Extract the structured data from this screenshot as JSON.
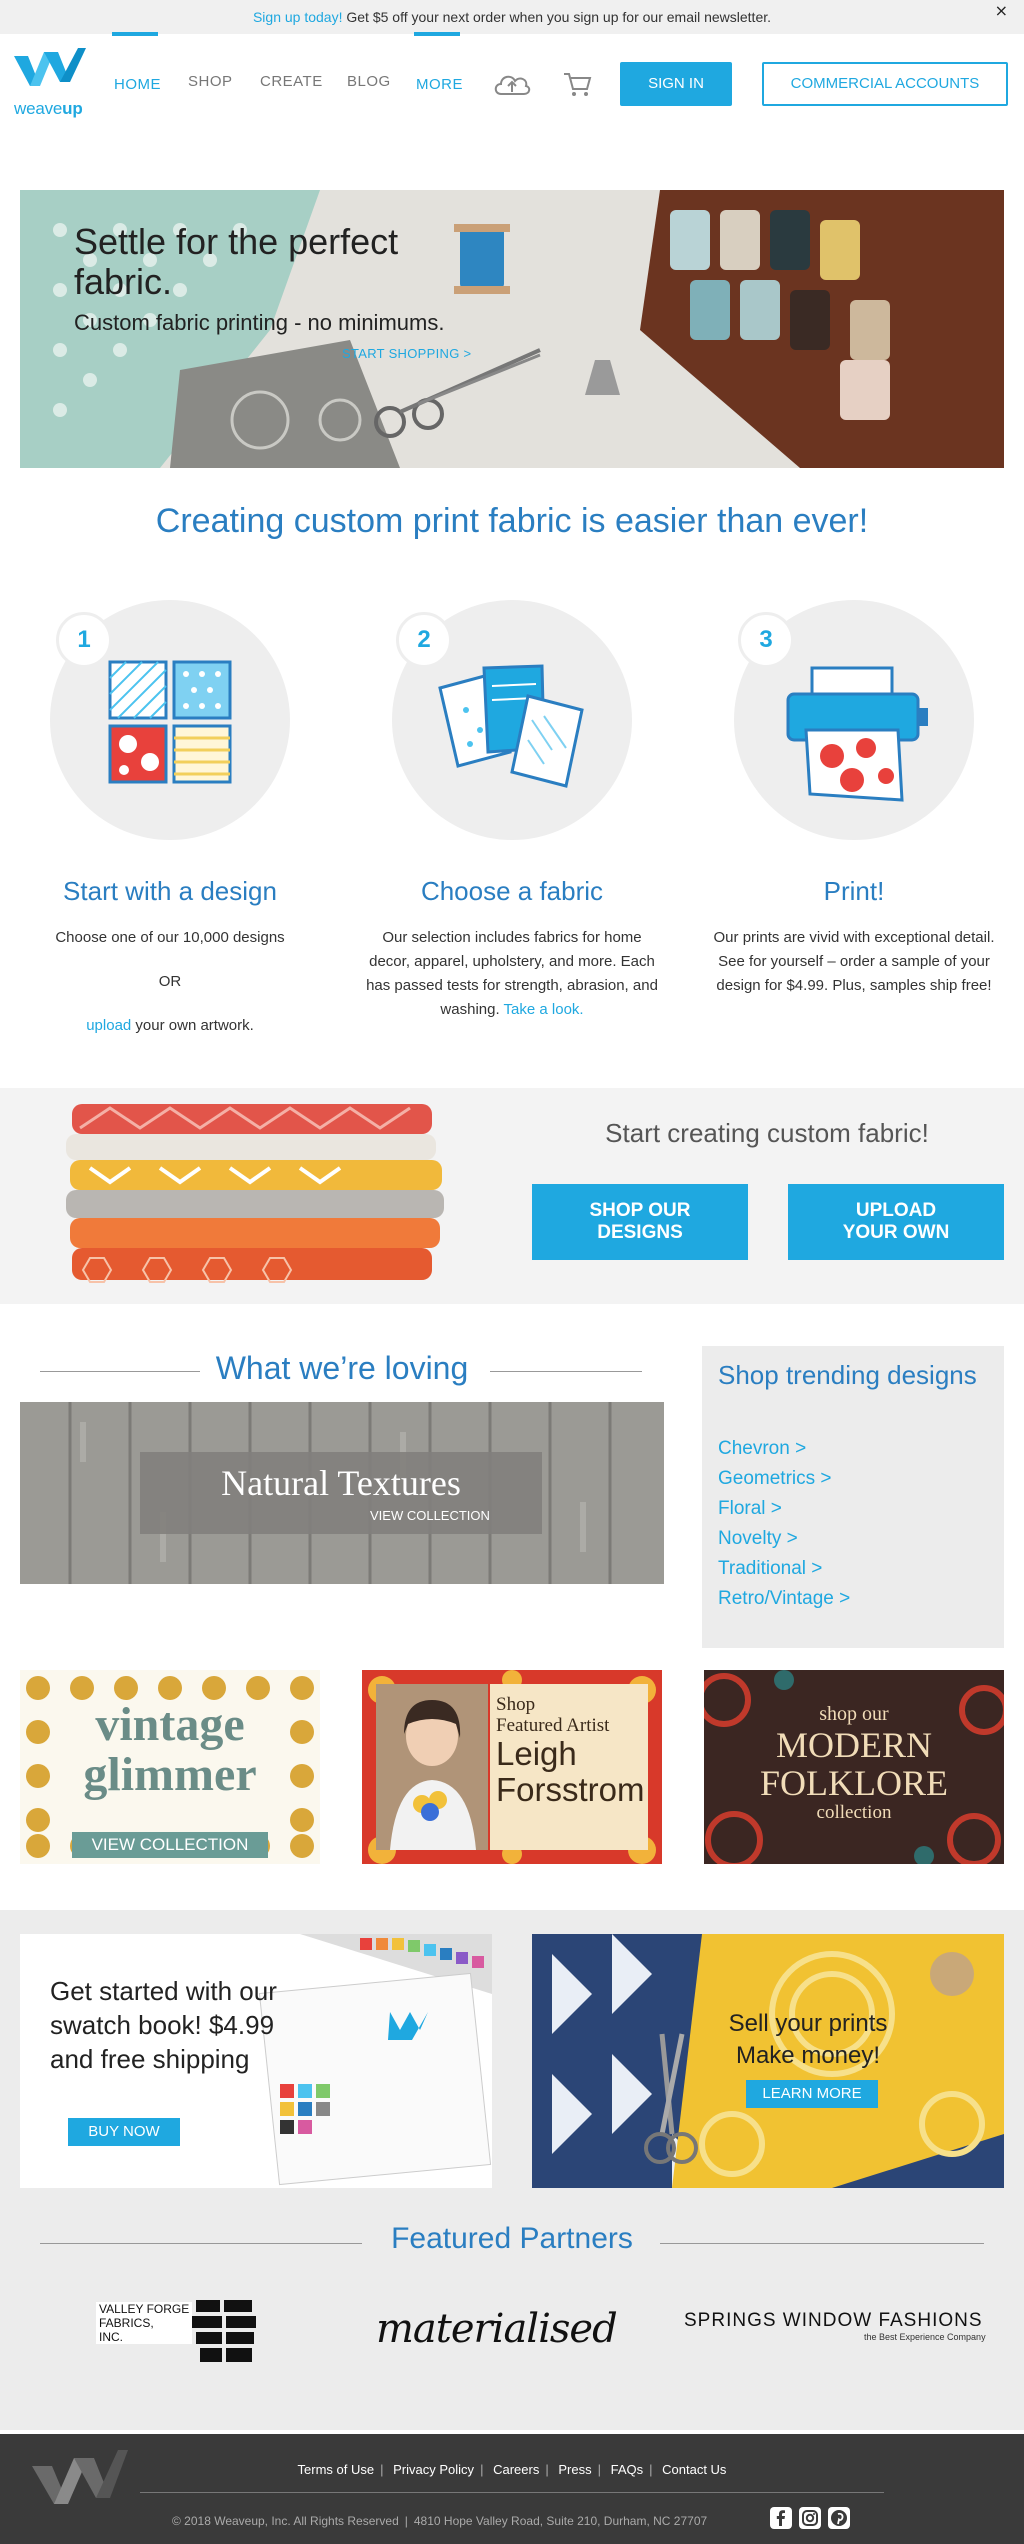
{
  "promo": {
    "highlight": "Sign up today!",
    "text": " Get $5 off your next order when you sign up for our email newsletter.",
    "close": "×"
  },
  "header": {
    "logo_word_a": "weave",
    "logo_word_b": "up",
    "nav": [
      {
        "label": "HOME"
      },
      {
        "label": "SHOP"
      },
      {
        "label": "CREATE"
      },
      {
        "label": "BLOG"
      },
      {
        "label": "MORE"
      }
    ],
    "signin": "SIGN IN",
    "commercial": "COMMERCIAL ACCOUNTS"
  },
  "hero": {
    "title": "Settle for the perfect fabric.",
    "subtitle": "Custom fabric printing - no minimums.",
    "cta": "START SHOPPING >"
  },
  "how": {
    "title": "Creating custom print fabric is easier than ever!",
    "steps": [
      {
        "num": "1",
        "title": "Start with a design",
        "line1": "Choose one of our 10,000 designs",
        "or": "OR",
        "upload_link": "upload",
        "upload_rest": " your own artwork."
      },
      {
        "num": "2",
        "title": "Choose a fabric",
        "text": "Our selection includes fabrics for home decor, apparel, upholstery, and more. Each has passed tests for strength, abrasion, and washing. ",
        "link": "Take a look."
      },
      {
        "num": "3",
        "title": "Print!",
        "text": "Our prints are vivid with exceptional detail. See for yourself – order a sample of your design for $4.99. Plus, samples ship free!"
      }
    ]
  },
  "band": {
    "title": "Start creating custom fabric!",
    "btn_shop": "SHOP OUR DESIGNS",
    "btn_upload": "UPLOAD YOUR OWN"
  },
  "loving": {
    "title": "What we’re loving",
    "feature_title": "Natural Textures",
    "feature_link": "VIEW COLLECTION"
  },
  "trending": {
    "title": "Shop trending designs",
    "items": [
      "Chevron >",
      "Geometrics >",
      "Floral >",
      "Novelty >",
      "Traditional >",
      "Retro/Vintage >"
    ]
  },
  "collections": {
    "vintage_a": "vintage",
    "vintage_b": "glimmer",
    "vintage_btn": "VIEW COLLECTION",
    "artist_shop": "Shop",
    "artist_featured": "Featured Artist",
    "artist_first": "Leigh",
    "artist_last": "Forsstrom",
    "folk_shop": "shop our",
    "folk_modern": "MODERN",
    "folk_folklore": "FOLKLORE",
    "folk_collection": "collection"
  },
  "swatch": {
    "text": "Get started with our swatch book! $4.99 and free shipping",
    "btn": "BUY NOW"
  },
  "sell": {
    "text": "Sell your prints Make money!",
    "btn": "LEARN MORE"
  },
  "partners": {
    "title": "Featured Partners",
    "vf_1": "VALLEY FORGE",
    "vf_2": "FABRICS,",
    "vf_3": "INC.",
    "materialised": "materialised",
    "springs": "SPRINGS WINDOW FASHIONS",
    "springs_tag": "the Best Experience Company"
  },
  "footer": {
    "links": [
      "Terms of Use",
      "Privacy Policy",
      "Careers",
      "Press",
      "FAQs",
      "Contact Us"
    ],
    "copyright": "© 2018 Weaveup, Inc. All Rights Reserved",
    "address": "4810 Hope Valley Road, Suite 210, Durham, NC 27707"
  },
  "colors": {
    "brand_blue": "#1fa8e0",
    "heading_blue": "#2a7ec1",
    "footer_bg": "#3a3a3a"
  },
  "icons": [
    "close-icon",
    "weaveup-logo",
    "cloud-upload-icon",
    "cart-icon",
    "facebook-icon",
    "instagram-icon",
    "pinterest-icon"
  ]
}
